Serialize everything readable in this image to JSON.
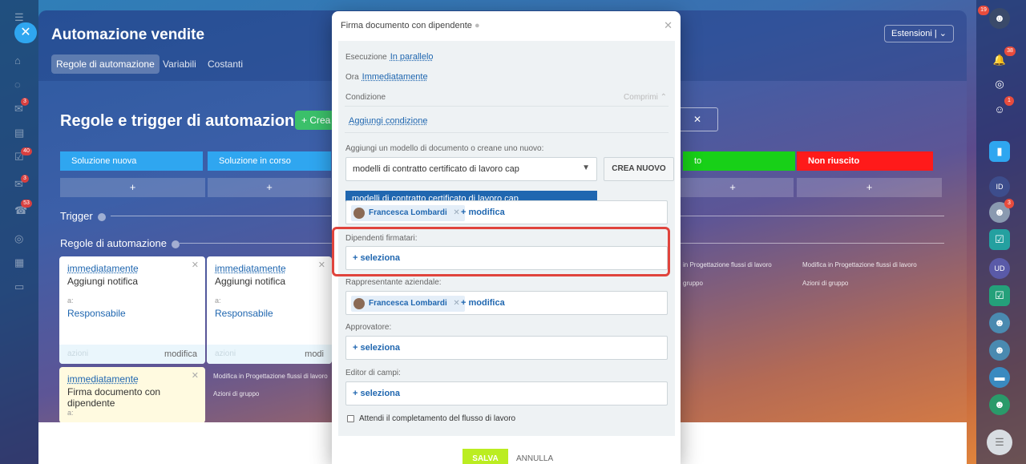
{
  "left_rail": {
    "menu_initial": "B",
    "items": [
      {
        "initial": "P",
        "badge": ""
      },
      {
        "initial": "C",
        "badge": ""
      },
      {
        "initial": "M",
        "badge": "3"
      },
      {
        "initial": "Fe",
        "badge": ""
      },
      {
        "initial": "In",
        "badge": "40"
      },
      {
        "initial": "W",
        "badge": "3"
      },
      {
        "initial": "C",
        "badge": "53"
      },
      {
        "initial": "C",
        "badge": ""
      },
      {
        "initial": "C",
        "badge": ""
      },
      {
        "initial": "D",
        "badge": ""
      }
    ]
  },
  "right_rail": {
    "badge_top": "19",
    "notifications_badge": "38",
    "chat_badge": "1",
    "user_badge": "3",
    "initials": [
      "ID",
      "UD"
    ]
  },
  "app": {
    "title": "Automazione vendite",
    "tabs": [
      "Regole di automazione",
      "Variabili",
      "Costanti"
    ],
    "extensions_label": "Estensioni"
  },
  "board": {
    "section_title": "Regole e trigger di automazione",
    "create_label": "Crea",
    "stages": [
      {
        "label": "Soluzione nuova",
        "color": "#2fa6f0"
      },
      {
        "label": "Soluzione in corso",
        "color": "#2fa6f0"
      },
      {
        "label": "to",
        "color": "#18d018"
      },
      {
        "label": "Non riuscito",
        "color": "#ff1a1a"
      }
    ],
    "plus": "+",
    "trigger_label": "Trigger",
    "rules_label": "Regole di automazione",
    "cards": [
      {
        "when": "immediatamente",
        "action": "Aggiungi notifica",
        "a": "a:",
        "resp": "Responsabile",
        "footer_left": "azioni",
        "footer_right": "modifica"
      },
      {
        "when": "immediatamente",
        "action": "Aggiungi notifica",
        "a": "a:",
        "resp": "Responsabile",
        "footer_left": "azioni",
        "footer_right": "modi"
      },
      {
        "when": "immediatamente",
        "action": "Firma documento con dipendente",
        "a": "a:"
      }
    ],
    "links": {
      "modify_flow": "Modifica in Progettazione flussi di lavoro",
      "modify_flow_partial": "in Progettazione flussi di lavoro",
      "group_actions": "Azioni di gruppo",
      "group_partial": "gruppo"
    }
  },
  "modal": {
    "title": "Firma documento con dipendente",
    "execution_label": "Esecuzione",
    "execution_value": "In parallelo",
    "time_label": "Ora",
    "time_value": "Immediatamente",
    "condition_label": "Condizione",
    "collapse_label": "Comprimi",
    "add_condition": "Aggiungi condizione",
    "template_label": "Aggiungi un modello di documento o creane uno nuovo:",
    "template_value": "modelli di contratto certificato di lavoro cap",
    "dropdown_option": "modelli di contratto certificato di lavoro cap",
    "create_new": "CREA NUOVO",
    "person_name": "Francesca Lombardi",
    "modify": "+ modifica",
    "signers_label": "Dipendenti firmatari:",
    "select": "+ seleziona",
    "company_rep_label": "Rappresentante aziendale:",
    "approver_label": "Approvatore:",
    "editor_label": "Editor di campi:",
    "wait_label": "Attendi il completamento del flusso di lavoro",
    "save": "SALVA",
    "cancel": "ANNULLA"
  }
}
